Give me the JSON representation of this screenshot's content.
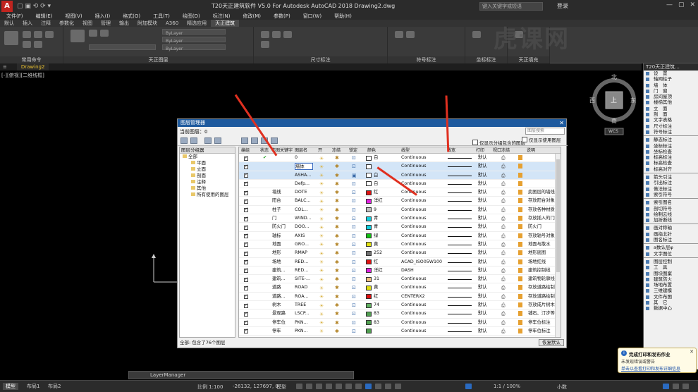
{
  "window": {
    "title": "T20天正建筑软件 V5.0 For Autodesk AutoCAD 2018    Drawing2.dwg",
    "search_placeholder": "键入关键字或短语",
    "login": "登录",
    "app_button": "A"
  },
  "menubar": [
    "文件(F)",
    "编辑(E)",
    "视图(V)",
    "插入(I)",
    "格式(O)",
    "工具(T)",
    "绘图(D)",
    "标注(N)",
    "修改(M)",
    "参数(P)",
    "窗口(W)",
    "帮助(H)"
  ],
  "ribbon_tabs": [
    "默认",
    "插入",
    "注释",
    "参数化",
    "视图",
    "管理",
    "输出",
    "附加模块",
    "A360",
    "精选应用",
    "天正建筑"
  ],
  "ribbon_panels": [
    "常用命令",
    "天正图层",
    "尺寸标注",
    "符号标注",
    "坐标标注",
    "天正填充"
  ],
  "ribbon_bylayer": [
    "ByLayer",
    "ByLayer",
    "ByLayer"
  ],
  "doc_tab": "Drawing2",
  "view_label": "[-][俯视][二维线框]",
  "navcube": {
    "north": "北",
    "south": "南",
    "east": "东",
    "west": "西",
    "top": "上",
    "wcs": "WCS"
  },
  "right_panel": {
    "title": "T20天正建筑...",
    "groups": [
      [
        "设　置",
        "轴网柱子",
        "墙　体",
        "门　窗",
        "房间屋顶",
        "楼梯其他",
        "立　面",
        "剖　面",
        "文字表格",
        "尺寸标注",
        "符号标注"
      ],
      [
        "静态标注",
        "坐标标注",
        "坐标检查",
        "标高标注",
        "标高检查",
        "标高对齐"
      ],
      [
        "箭头引注",
        "引出标注",
        "做法标注",
        "索引符号"
      ],
      [
        "索引图名",
        "剖切符号",
        "绘制云线",
        "加折断线"
      ],
      [
        "画对称轴",
        "画指北针",
        "图名标注"
      ],
      [
        "a数认层φ",
        "文字图位"
      ],
      [
        "图层控制",
        "工　具",
        "图块图案",
        "建筑防火",
        "场地布置",
        "三维建模",
        "文件布图",
        "其　它",
        "数据中心"
      ]
    ]
  },
  "layer_dialog": {
    "title": "图层管理器",
    "current_layer": "当前图层：0",
    "search_placeholder": "图层搜索",
    "options": [
      "仅显示分组包含的图层",
      "仅显示使用图层"
    ],
    "filter_title": "图层分组器",
    "tree": [
      {
        "label": "全部",
        "level": 0
      },
      {
        "label": "平面",
        "level": 1
      },
      {
        "label": "立面",
        "level": 1
      },
      {
        "label": "剖面",
        "level": 1
      },
      {
        "label": "注释",
        "level": 1
      },
      {
        "label": "其他",
        "level": 1
      },
      {
        "label": "所有使用的图层",
        "level": 1
      }
    ],
    "columns": [
      "编组",
      "状态",
      "布图关键字",
      "图层名",
      "开",
      "冻结",
      "锁定",
      "颜色",
      "线型",
      "线宽",
      "打印",
      "视口冻结",
      "说明"
    ],
    "rows": [
      {
        "status": "✔",
        "key": "",
        "name": "0",
        "color": "白",
        "swatch": "#ffffff",
        "linetype": "Continuous",
        "weight": "默认",
        "desc": "",
        "locked": false
      },
      {
        "status": "",
        "key": "",
        "name": "墙体",
        "color": "",
        "swatch": "#ffffff",
        "linetype": "Continuous",
        "weight": "默认",
        "desc": "",
        "locked": false,
        "selected": true,
        "editing": true
      },
      {
        "status": "",
        "key": "",
        "name": "ASHA...",
        "color": "白",
        "swatch": "#ffffff",
        "linetype": "Continuous",
        "weight": "默认",
        "desc": "",
        "locked": true,
        "selected": true
      },
      {
        "status": "",
        "key": "",
        "name": "Defp...",
        "color": "白",
        "swatch": "#ffffff",
        "linetype": "Continuous",
        "weight": "默认",
        "desc": "",
        "locked": false
      },
      {
        "status": "",
        "key": "墙线",
        "key_full": "墙线",
        "name": "DOTE",
        "color": "红",
        "swatch": "#e01010",
        "linetype": "Continuous",
        "weight": "默认",
        "desc": "此图层的墙线和",
        "locked": false
      },
      {
        "status": "",
        "key": "阳台",
        "name": "BALC...",
        "color": "洋红",
        "swatch": "#e020e0",
        "linetype": "Continuous",
        "weight": "默认",
        "desc": "存放阳台对象...",
        "locked": false
      },
      {
        "status": "",
        "key": "柱子",
        "name": "COL...",
        "color": "9",
        "swatch": "#c0c0c0",
        "linetype": "Continuous",
        "weight": "默认",
        "desc": "存放各种材质的",
        "locked": false
      },
      {
        "status": "",
        "key": "门",
        "name": "WIND...",
        "color": "青",
        "swatch": "#10d0e0",
        "linetype": "Continuous",
        "weight": "默认",
        "desc": "存放插入的门窗",
        "locked": false
      },
      {
        "status": "",
        "key": "防火门",
        "name": "DOO...",
        "color": "青",
        "swatch": "#10d0e0",
        "linetype": "Continuous",
        "weight": "默认",
        "desc": "防火门",
        "locked": false
      },
      {
        "status": "",
        "key": "轴标",
        "name": "AXIS",
        "color": "绿",
        "swatch": "#10c010",
        "linetype": "Continuous",
        "weight": "默认",
        "desc": "存放轴号对象",
        "locked": false
      },
      {
        "status": "",
        "key": "地面",
        "name": "GRO...",
        "color": "黄",
        "swatch": "#e0e010",
        "linetype": "Continuous",
        "weight": "默认",
        "desc": "地面与散水",
        "locked": false
      },
      {
        "status": "",
        "key": "地形",
        "name": "RMAP",
        "color": "252",
        "swatch": "#707070",
        "linetype": "Continuous",
        "weight": "默认",
        "desc": "地形底图",
        "locked": false
      },
      {
        "status": "",
        "key": "场地",
        "name": "RED...",
        "color": "红",
        "swatch": "#e01010",
        "linetype": "ACAD_ISO05W100",
        "weight": "默认",
        "desc": "场地红线",
        "locked": false
      },
      {
        "status": "",
        "key": "建筑...",
        "name": "RED...",
        "color": "洋红",
        "swatch": "#e020e0",
        "linetype": "DASH",
        "weight": "默认",
        "desc": "建筑控制线",
        "locked": false
      },
      {
        "status": "",
        "key": "建筑...",
        "name": "SITE-...",
        "color": "31",
        "swatch": "#f0c080",
        "linetype": "Continuous",
        "weight": "默认",
        "desc": "建筑物轮廓线",
        "locked": false
      },
      {
        "status": "",
        "key": "道路",
        "name": "ROAD",
        "color": "黄",
        "swatch": "#e0e010",
        "linetype": "Continuous",
        "weight": "默认",
        "desc": "存放道路绘制线",
        "locked": false
      },
      {
        "status": "",
        "key": "道路...",
        "name": "ROA...",
        "color": "红",
        "swatch": "#e01010",
        "linetype": "CENTERX2",
        "weight": "默认",
        "desc": "存放道路绘制线",
        "locked": false
      },
      {
        "status": "",
        "key": "树木",
        "name": "TREE",
        "color": "74",
        "swatch": "#60b060",
        "linetype": "Continuous",
        "weight": "默认",
        "desc": "存放成片树木和",
        "locked": false
      },
      {
        "status": "",
        "key": "景观路",
        "name": "LSCP...",
        "color": "83",
        "swatch": "#50a050",
        "linetype": "Continuous",
        "weight": "默认",
        "desc": "铺石、汀步等景",
        "locked": false
      },
      {
        "status": "",
        "key": "停车位",
        "name": "PKN...",
        "color": "83",
        "swatch": "#50a050",
        "linetype": "Continuous",
        "weight": "默认",
        "desc": "停车位标注",
        "locked": false
      },
      {
        "status": "",
        "key": "停车",
        "name": "PKN...",
        "color": "",
        "swatch": "#50a050",
        "linetype": "Continuous",
        "weight": "默认",
        "desc": "停车位标注",
        "locked": false
      }
    ],
    "status_text": "全部: 包含了76个图层",
    "keep_button": "恢复默认"
  },
  "command_line": "LayerManager",
  "status_tabs": [
    "模型",
    "布局1",
    "布局2"
  ],
  "status_readout": "-26132, 127697, 0",
  "status_model": "模型",
  "status_scale": "比例 1:100",
  "status_zoom": "1:1 / 100%",
  "status_units": "小数",
  "notification": {
    "title": "完成打印和发布作业",
    "line1": "未发现错误或警告",
    "link": "单击以查看打印和发布详细信息"
  },
  "watermark": "虎课网",
  "accent": "#1e5a9e"
}
